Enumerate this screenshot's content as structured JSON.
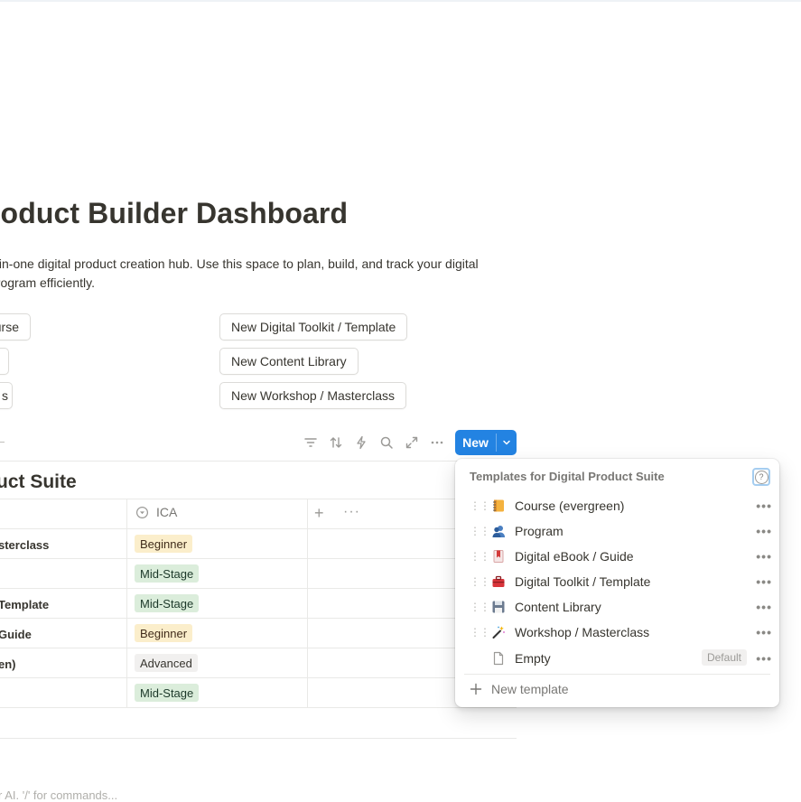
{
  "page": {
    "title": "roduct Builder Dashboard",
    "description": "ll-in-one digital product creation hub. Use this space to plan, build, and track your digital program efficiently."
  },
  "buttons": {
    "left": [
      "urse",
      "",
      "s"
    ],
    "right": [
      "New Digital Toolkit / Template",
      "New Content Library",
      "New Workshop / Masterclass"
    ]
  },
  "toolbar": {
    "icons": [
      "filter-icon",
      "sort-icon",
      "automation-icon",
      "search-icon",
      "expand-icon",
      "more-icon"
    ],
    "new_label": "New",
    "new_chevron": "chevron-down-icon"
  },
  "database": {
    "title": "uct Suite",
    "column_ica": "ICA",
    "rows": [
      {
        "name": "sterclass",
        "ica": "Beginner"
      },
      {
        "name": "",
        "ica": "Mid-Stage"
      },
      {
        "name": "Template",
        "ica": "Mid-Stage"
      },
      {
        "name": "Guide",
        "ica": "Beginner"
      },
      {
        "name": "en)",
        "ica": "Advanced"
      },
      {
        "name": "",
        "ica": "Mid-Stage"
      }
    ]
  },
  "footer_hint": "r AI. '/' for commands...",
  "templates_popup": {
    "title": "Templates for Digital Product Suite",
    "items": [
      {
        "label": "Course (evergreen)",
        "icon": "notebook-icon"
      },
      {
        "label": "Program",
        "icon": "people-icon"
      },
      {
        "label": "Digital eBook / Guide",
        "icon": "bookmark-icon"
      },
      {
        "label": "Digital Toolkit / Template",
        "icon": "toolbox-icon"
      },
      {
        "label": "Content Library",
        "icon": "floppy-disk-icon"
      },
      {
        "label": "Workshop / Masterclass",
        "icon": "magic-wand-icon"
      }
    ],
    "empty_label": "Empty",
    "default_badge": "Default",
    "new_template_label": "New template"
  },
  "colors": {
    "accent": "#2383e2",
    "beginner_bg": "#fbeecb",
    "mid_stage_bg": "#dbeddb",
    "advanced_bg": "#f1f0ef"
  }
}
